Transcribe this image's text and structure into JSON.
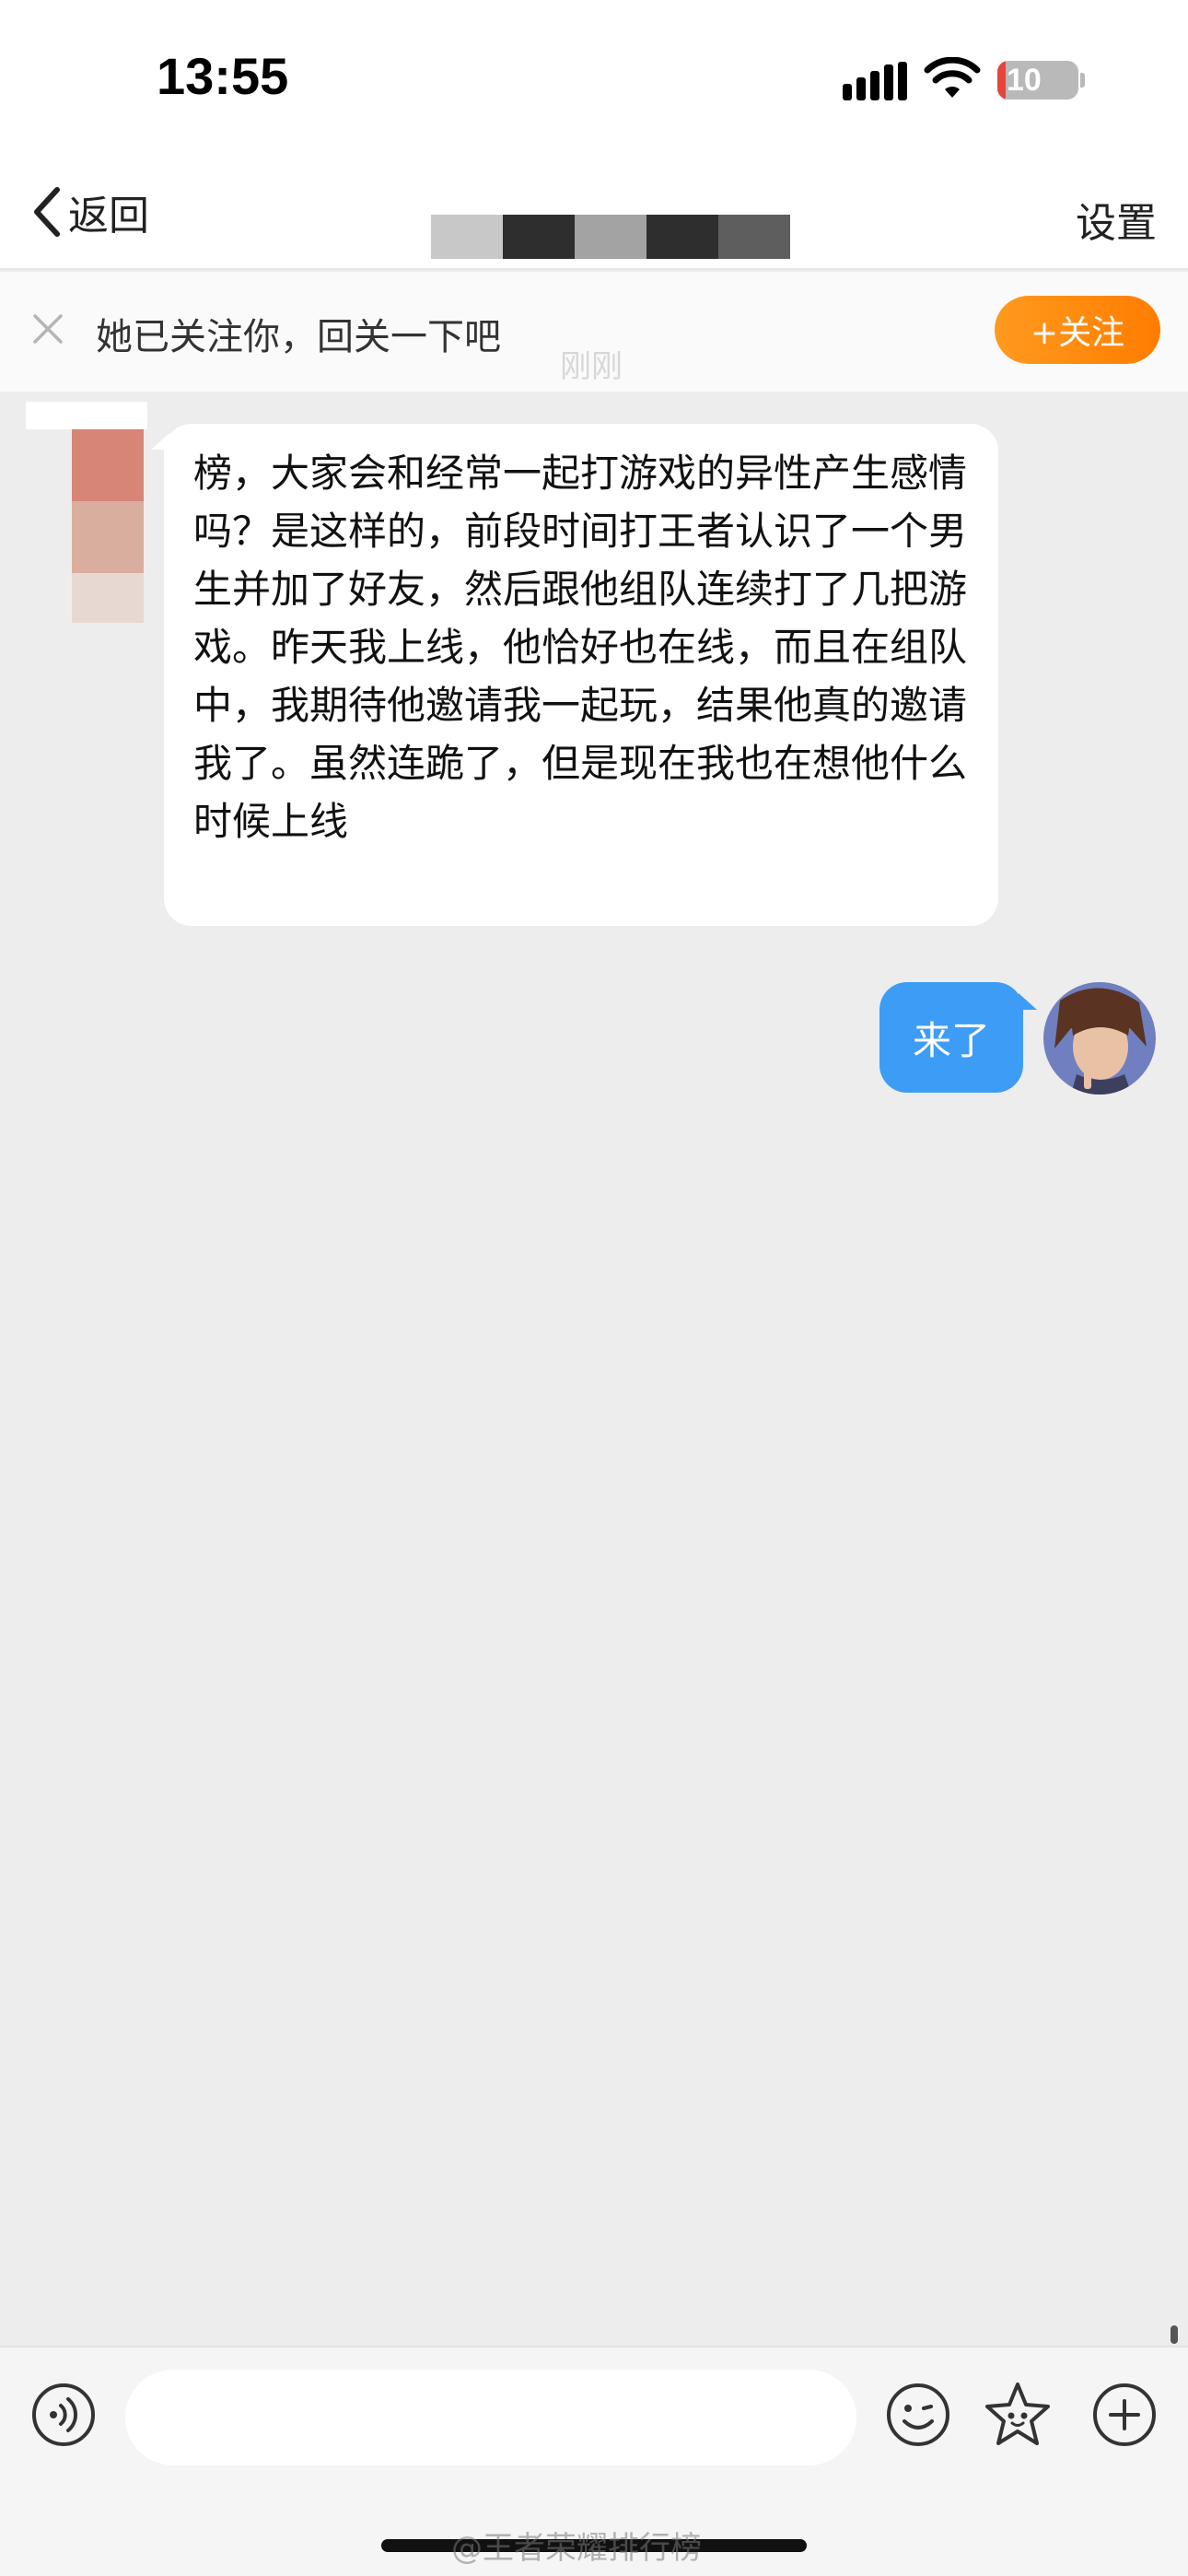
{
  "status_bar": {
    "time": "13:55",
    "battery_level": "10",
    "battery_percent": 10
  },
  "nav": {
    "back_label": "返回",
    "settings_label": "设置"
  },
  "follow_prompt": {
    "text": "她已关注你，回关一下吧",
    "button_label": "+关注",
    "faint_time": "刚刚"
  },
  "messages": [
    {
      "side": "left",
      "text": "榜，大家会和经常一起打游戏的异性产生感情吗？是这样的，前段时间打王者认识了一个男生并加了好友，然后跟他组队连续打了几把游戏。昨天我上线，他恰好也在线，而且在组队中，我期待他邀请我一起玩，结果他真的邀请我了。虽然连跪了，但是现在我也在想他什么时候上线"
    },
    {
      "side": "right",
      "text": "来了"
    }
  ],
  "input": {
    "value": ""
  },
  "watermark": "@王者荣耀排行榜",
  "colors": {
    "accent_blue": "#3d9cf5",
    "follow_orange": "#ff8c0a",
    "chat_background": "#ededed"
  },
  "icons": {
    "back": "chevron-left-icon",
    "close": "close-icon",
    "voice": "voice-icon",
    "emoji": "emoji-icon",
    "sticker": "star-icon",
    "more": "plus-icon"
  }
}
